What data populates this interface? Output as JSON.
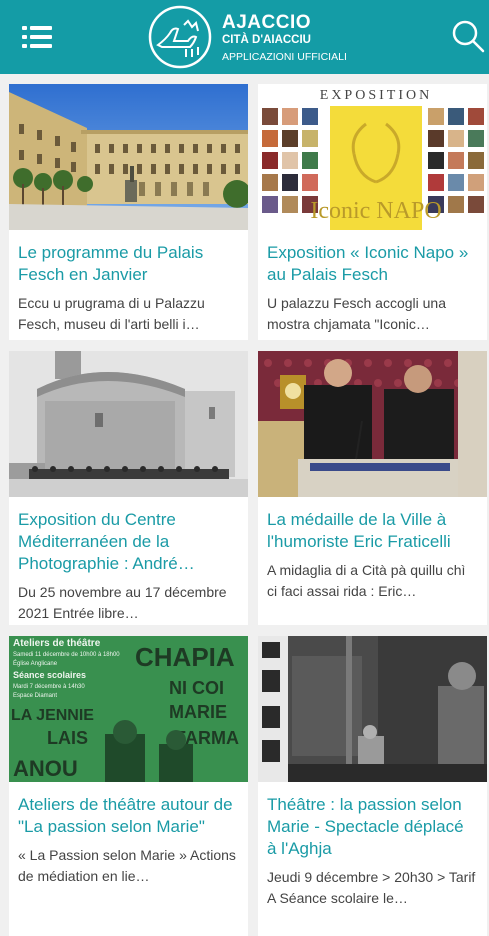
{
  "header": {
    "title": "AJACCIO",
    "subtitle": "CITÀ D'AIACCIU",
    "tagline": "APPLICAZIONI UFFICIALI",
    "menu_icon": "menu-icon",
    "search_icon": "search-icon",
    "accent_color": "#149ca6",
    "link_color": "#1a9ba6"
  },
  "articles": [
    {
      "title": "Le programme du Palais Fesch en Janvier",
      "summary": "Eccu u prugrama di u Palazzu Fesch, museu di l'arti belli i…"
    },
    {
      "title": "Exposition « Iconic Napo » au Palais Fesch",
      "summary": "U palazzu Fesch accogli una mostra chjamata \"Iconic…",
      "image_text_top": "EXPOSITION",
      "image_text_cover": "Iconic NAPO"
    },
    {
      "title": "Exposition du Centre Méditerranéen de la Photographie : André…",
      "summary": "Du 25 novembre au 17 décembre 2021 Entrée libre…"
    },
    {
      "title": "La médaille de la Ville à l'humoriste Eric Fraticelli",
      "summary": "A midaglia di a Cità pà quillu chì ci faci assai rida : Eric…"
    },
    {
      "title": "Ateliers de théâtre autour de \"La passion selon Marie\"",
      "summary": "« La Passion selon Marie » Actions de médiation en lie…",
      "image_text": [
        "Ateliers de théâtre",
        "Samedi 11 décembre de 10h00 à 18h00",
        "Église Anglicane",
        "Séance scolaires",
        "Mardi 7 décembre à 14h30",
        "Espace Diamant",
        "CHAPIA",
        "NI COI",
        "MARIE",
        "LA JENNIE",
        "LAIS",
        "FARMA",
        "ANOU"
      ]
    },
    {
      "title": "Théâtre : la passion selon Marie - Spectacle déplacé à l'Aghja",
      "summary": "Jeudi 9 décembre > 20h30 > Tarif A Séance scolaire le…"
    }
  ]
}
